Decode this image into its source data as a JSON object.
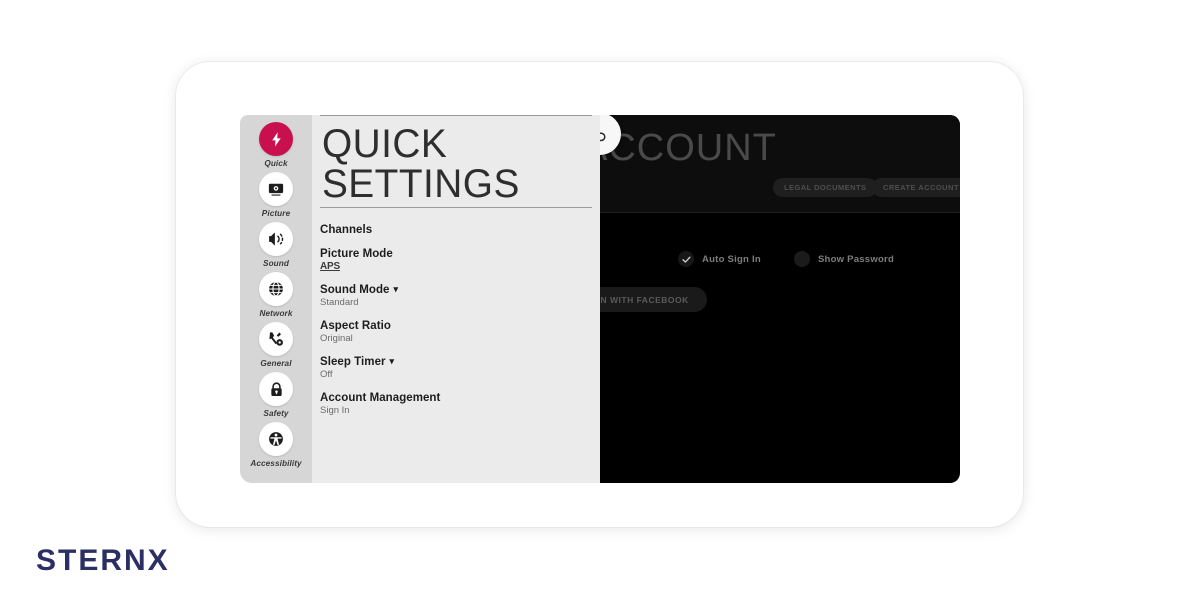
{
  "brand": {
    "name": "STERNX",
    "color": "#2b2f63"
  },
  "theme": {
    "accent": "#c8104f",
    "sidebar_bg": "#d6d6d6",
    "panel_bg": "#ebebeb",
    "dark_panel_bg": "#000000",
    "card_bg": "#ffffff"
  },
  "sidebar": {
    "items": [
      {
        "label": "Quick",
        "icon": "lightning-bolt-icon",
        "active": true
      },
      {
        "label": "Picture",
        "icon": "monitor-icon",
        "active": false
      },
      {
        "label": "Sound",
        "icon": "speaker-icon",
        "active": false
      },
      {
        "label": "Network",
        "icon": "globe-icon",
        "active": false
      },
      {
        "label": "General",
        "icon": "wrench-gear-icon",
        "active": false
      },
      {
        "label": "Safety",
        "icon": "lock-icon",
        "active": false
      },
      {
        "label": "Accessibility",
        "icon": "accessibility-icon",
        "active": false
      }
    ]
  },
  "quick_settings": {
    "title": "QUICK SETTINGS",
    "rows": [
      {
        "name": "Channels",
        "value": "",
        "has_chevron": false
      },
      {
        "name": "Picture Mode",
        "value": "APS",
        "has_chevron": false
      },
      {
        "name": "Sound Mode",
        "value": "Standard",
        "has_chevron": true
      },
      {
        "name": "Aspect Ratio",
        "value": "Original",
        "has_chevron": false
      },
      {
        "name": "Sleep Timer",
        "value": "Off",
        "has_chevron": true
      },
      {
        "name": "Account Management",
        "value": "Sign In",
        "has_chevron": false
      }
    ]
  },
  "account_panel": {
    "title": "ACCOUNT",
    "back_icon": "back-arrow-icon",
    "buttons": {
      "legal_documents": "LEGAL DOCUMENTS",
      "create_account": "CREATE ACCOUNT",
      "facebook": "SIGN IN WITH FACEBOOK"
    },
    "checkboxes": [
      {
        "label": "Auto Sign In",
        "checked": true
      },
      {
        "label": "Show Password",
        "checked": false
      }
    ]
  }
}
